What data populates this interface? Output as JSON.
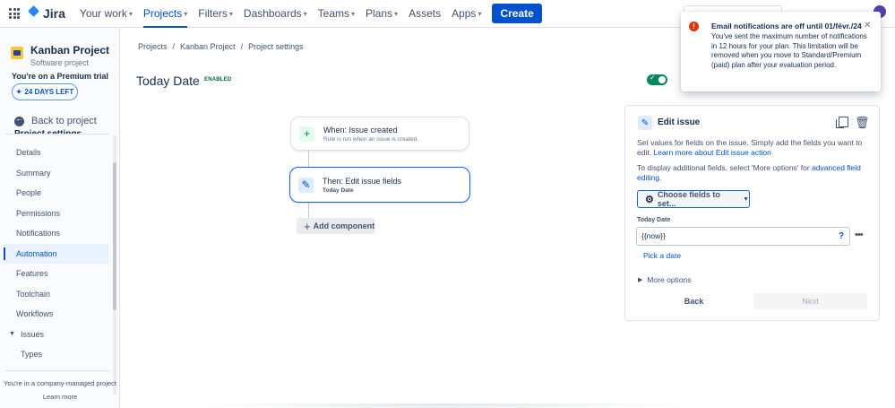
{
  "topnav": {
    "logo": "Jira",
    "items": [
      {
        "label": "Your work",
        "chevron": true,
        "active": false
      },
      {
        "label": "Projects",
        "chevron": true,
        "active": true
      },
      {
        "label": "Filters",
        "chevron": true,
        "active": false
      },
      {
        "label": "Dashboards",
        "chevron": true,
        "active": false
      },
      {
        "label": "Teams",
        "chevron": true,
        "active": false
      },
      {
        "label": "Plans",
        "chevron": true,
        "active": false
      },
      {
        "label": "Assets",
        "chevron": false,
        "active": false
      },
      {
        "label": "Apps",
        "chevron": true,
        "active": false
      }
    ],
    "create_label": "Create"
  },
  "sidebar": {
    "project_name": "Kanban Project",
    "project_type": "Software project",
    "trial_text": "You're on a Premium trial",
    "days_left": "24 DAYS LEFT",
    "back_label": "Back to project",
    "section_clipped": "Project settings",
    "items": [
      {
        "label": "Details"
      },
      {
        "label": "Summary"
      },
      {
        "label": "People"
      },
      {
        "label": "Permissions"
      },
      {
        "label": "Notifications"
      },
      {
        "label": "Automation"
      },
      {
        "label": "Features"
      },
      {
        "label": "Toolchain"
      },
      {
        "label": "Workflows"
      },
      {
        "label": "Issues"
      },
      {
        "label": "Types"
      }
    ],
    "company_text": "You're in a company-managed project",
    "learn_more": "Learn more"
  },
  "breadcrumb": [
    "Projects",
    "Kanban Project",
    "Project settings"
  ],
  "rule": {
    "title": "Today Date",
    "status": "ENABLED",
    "trigger": {
      "title": "When: Issue created",
      "subtitle": "Rule is run when an issue is created."
    },
    "action": {
      "title": "Then: Edit issue fields",
      "subtitle": "Today Date"
    },
    "add_component": "Add component"
  },
  "edit_panel": {
    "title": "Edit issue",
    "desc_text": "Set values for fields on the issue. Simply add the fields you want to edit. ",
    "desc_link": "Learn more about Edit issue action",
    "more_text": "To display additional fields, select 'More options' for ",
    "more_link": "advanced field editing",
    "more_end": ".",
    "choose_label": "Choose fields to set...",
    "field_label": "Today Date",
    "field_value": "{{now}}",
    "pick_date": "Pick a date",
    "more_options": "More options",
    "back_label": "Back",
    "next_label": "Next"
  },
  "toast": {
    "title": "Email notifications are off until 01/févr./24",
    "body": "You've sent the maximum number of notifications in 12 hours for your plan. This limitation will be removed when you move to Standard/Premium (paid) plan after your evaluation period."
  },
  "colors": {
    "brand": "#0052cc",
    "enabled": "#00875a",
    "error": "#de350b"
  }
}
